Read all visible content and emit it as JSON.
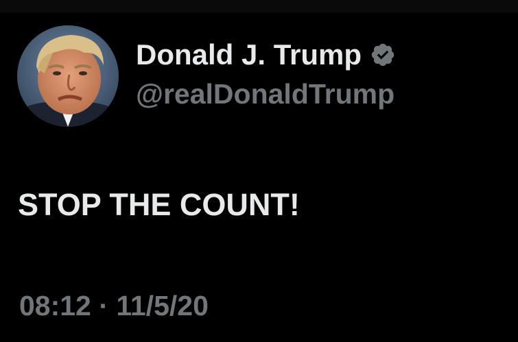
{
  "author": {
    "display_name": "Donald J. Trump",
    "handle": "@realDonaldTrump",
    "verified": true,
    "verified_icon": "verified-badge-icon",
    "verified_color": "#71767b"
  },
  "tweet": {
    "text": "STOP THE COUNT!",
    "time": "08:12",
    "separator": "·",
    "date": "11/5/20"
  },
  "colors": {
    "background": "#000000",
    "primary_text": "#e7e9ea",
    "secondary_text": "#71767b"
  }
}
